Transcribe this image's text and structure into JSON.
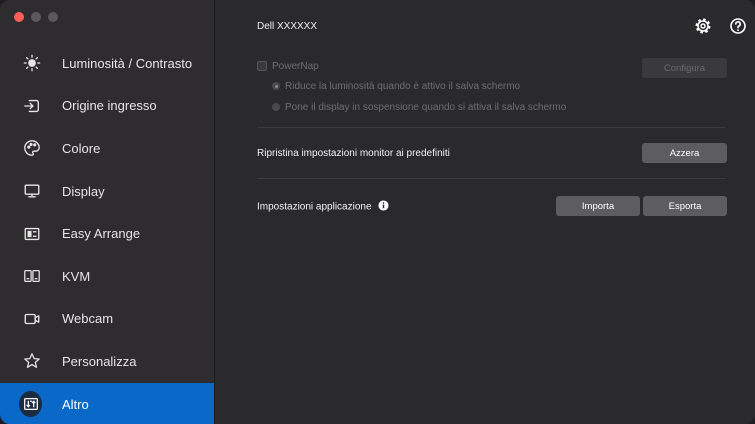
{
  "window": {
    "controls": [
      "close",
      "minimize",
      "maximize"
    ]
  },
  "sidebar": {
    "items": [
      {
        "label": "Luminosità / Contrasto",
        "icon": "brightness-icon"
      },
      {
        "label": "Origine ingresso",
        "icon": "input-source-icon"
      },
      {
        "label": "Colore",
        "icon": "color-icon"
      },
      {
        "label": "Display",
        "icon": "display-icon"
      },
      {
        "label": "Easy Arrange",
        "icon": "easy-arrange-icon"
      },
      {
        "label": "KVM",
        "icon": "kvm-icon"
      },
      {
        "label": "Webcam",
        "icon": "webcam-icon"
      },
      {
        "label": "Personalizza",
        "icon": "star-icon"
      },
      {
        "label": "Altro",
        "icon": "others-icon",
        "active": true
      }
    ]
  },
  "header": {
    "title": "Dell XXXXXX",
    "icons": [
      "gear-icon",
      "help-icon"
    ]
  },
  "powernap": {
    "label": "PowerNap",
    "option1": "Riduce la luminosità quando è attivo il salva schermo",
    "option2": "Pone il display in sospensione quando si attiva il salva schermo",
    "configure_label": "Configura"
  },
  "reset": {
    "label": "Ripristina impostazioni monitor ai predefiniti",
    "button_label": "Azzera"
  },
  "app_settings": {
    "label": "Impostazioni applicazione",
    "import_label": "Importa",
    "export_label": "Esporta"
  },
  "colors": {
    "accent": "#0a68c8",
    "sidebar_bg": "#2e2c2e",
    "main_bg": "#2a2a2c"
  }
}
